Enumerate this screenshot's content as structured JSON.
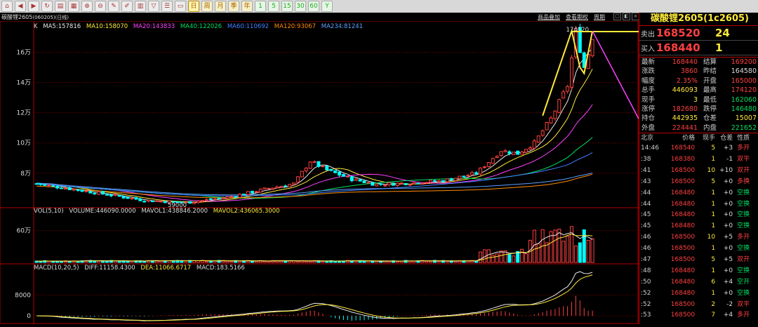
{
  "toolbar": {
    "buttons": [
      "home-icon",
      "back-icon",
      "forward-icon",
      "refresh-icon",
      "chart-icon",
      "grid-icon",
      "zoom-in-icon",
      "zoom-out-icon",
      "draw-icon",
      "pen-icon",
      "indicator-icon",
      "filter-icon",
      "list-icon",
      "window-icon",
      "one-min",
      "five-min",
      "fifteen-min",
      "thirty-min",
      "sixty-min",
      "daily",
      "weekly",
      "monthly",
      "quarterly",
      "yearly",
      "custom"
    ],
    "labels": [
      "⌂",
      "◀",
      "▶",
      "↻",
      "▤",
      "▦",
      "⊕",
      "⊖",
      "✎",
      "✐",
      "▥",
      "▽",
      "☰",
      "▭",
      "日",
      "周",
      "月",
      "季",
      "年",
      "1",
      "5",
      "15",
      "30",
      "60",
      "Y"
    ]
  },
  "header": {
    "symbol": "碳酸锂2605",
    "symbol_code": "(060205)",
    "period": "(日线)",
    "link_overlay": "商品叠加",
    "link_period": "查看期权",
    "link_cycle": "周期",
    "win_buttons": [
      "▢",
      "◧",
      "×"
    ]
  },
  "indicators": {
    "k_label": "K",
    "ma5": "MA5:157816",
    "ma10": "MA10:158070",
    "ma20": "MA20:143833",
    "ma40": "MA40:122026",
    "ma60": "MA60:110692",
    "ma120": "MA120:93067",
    "ma234": "MA234:81241",
    "vol_title": "VOL(5,10)",
    "volume": "VOLUME:446090.0000",
    "mavol1": "MAVOL1:438846.2000",
    "mavol2": "MAVOL2:436065.3000",
    "macd_title": "MACD(10,20,5)",
    "diff": "DIFF:11158.4300",
    "dea": "DEA:11066.6717",
    "macd": "MACD:183.5166"
  },
  "axis": {
    "price_labels": [
      "16万",
      "14万",
      "12万",
      "10万",
      "8万"
    ],
    "vol_label": "60万",
    "macd_labels": [
      "8000",
      "0"
    ],
    "low_label": "59000",
    "high_label": "174120"
  },
  "colors": {
    "up": "#ff4040",
    "down": "#00ffff",
    "ma5": "#e8e8e8",
    "ma10": "#ffea3a",
    "ma20": "#ff40ff",
    "ma40": "#00e060",
    "ma60": "#4080ff",
    "ma120": "#ff8c00",
    "ma234": "#5aa0ff"
  },
  "quote": {
    "title": "碳酸锂2605(1c2605)",
    "ask_label": "卖出",
    "ask_price": "168520",
    "ask_vol": "24",
    "bid_label": "买入",
    "bid_price": "168440",
    "bid_vol": "1",
    "rows": [
      {
        "l": "最新",
        "v1": "168440",
        "c1": "red",
        "l2": "结算",
        "v2": "169200",
        "c2": "red"
      },
      {
        "l": "涨跌",
        "v1": "3860",
        "c1": "red",
        "l2": "昨结",
        "v2": "164580",
        "c2": "white"
      },
      {
        "l": "幅度",
        "v1": "2.35%",
        "c1": "red",
        "l2": "开盘",
        "v2": "165000",
        "c2": "red"
      },
      {
        "l": "总手",
        "v1": "446093",
        "c1": "yellow",
        "l2": "最高",
        "v2": "174120",
        "c2": "red"
      },
      {
        "l": "现手",
        "v1": "3",
        "c1": "yellow",
        "l2": "最低",
        "v2": "162060",
        "c2": "green"
      },
      {
        "l": "涨停",
        "v1": "182680",
        "c1": "red",
        "l2": "跌停",
        "v2": "146480",
        "c2": "green"
      },
      {
        "l": "持仓",
        "v1": "442935",
        "c1": "yellow",
        "l2": "仓差",
        "v2": "15007",
        "c2": "yellow"
      },
      {
        "l": "外盘",
        "v1": "224441",
        "c1": "red",
        "l2": "内盘",
        "v2": "221652",
        "c2": "green"
      }
    ]
  },
  "ticks": {
    "headers": [
      "北京",
      "价格",
      "现手",
      "仓差",
      "性质"
    ],
    "rows": [
      {
        "t": "14:46",
        "p": "168540",
        "v": "5",
        "oi": "+3",
        "n": "多开",
        "pc": "red",
        "nc": "red"
      },
      {
        "t": ":38",
        "p": "168380",
        "v": "1",
        "oi": "-1",
        "n": "双平",
        "pc": "red",
        "nc": "red"
      },
      {
        "t": ":41",
        "p": "168500",
        "v": "10",
        "oi": "+10",
        "n": "双开",
        "pc": "red",
        "nc": "red"
      },
      {
        "t": ":43",
        "p": "168500",
        "v": "5",
        "oi": "+0",
        "n": "多换",
        "pc": "red",
        "nc": "red"
      },
      {
        "t": ":44",
        "p": "168480",
        "v": "1",
        "oi": "+0",
        "n": "空换",
        "pc": "red",
        "nc": "green"
      },
      {
        "t": ":44",
        "p": "168480",
        "v": "1",
        "oi": "+0",
        "n": "空换",
        "pc": "red",
        "nc": "green"
      },
      {
        "t": ":45",
        "p": "168480",
        "v": "1",
        "oi": "+0",
        "n": "空换",
        "pc": "red",
        "nc": "green"
      },
      {
        "t": ":45",
        "p": "168480",
        "v": "1",
        "oi": "+0",
        "n": "空换",
        "pc": "red",
        "nc": "green"
      },
      {
        "t": ":46",
        "p": "168500",
        "v": "10",
        "oi": "+5",
        "n": "多开",
        "pc": "red",
        "nc": "red"
      },
      {
        "t": ":46",
        "p": "168500",
        "v": "1",
        "oi": "+0",
        "n": "空换",
        "pc": "red",
        "nc": "green"
      },
      {
        "t": ":47",
        "p": "168500",
        "v": "5",
        "oi": "+5",
        "n": "双开",
        "pc": "red",
        "nc": "red"
      },
      {
        "t": ":48",
        "p": "168480",
        "v": "1",
        "oi": "+0",
        "n": "空换",
        "pc": "red",
        "nc": "green"
      },
      {
        "t": ":50",
        "p": "168480",
        "v": "6",
        "oi": "+4",
        "n": "空开",
        "pc": "red",
        "nc": "green"
      },
      {
        "t": ":52",
        "p": "168480",
        "v": "1",
        "oi": "+0",
        "n": "空换",
        "pc": "red",
        "nc": "green"
      },
      {
        "t": ":52",
        "p": "168500",
        "v": "2",
        "oi": "-2",
        "n": "双平",
        "pc": "red",
        "nc": "red"
      },
      {
        "t": ":53",
        "p": "168500",
        "v": "7",
        "oi": "+4",
        "n": "多开",
        "pc": "red",
        "nc": "red"
      }
    ]
  },
  "chart_data": {
    "type": "candlestick",
    "y_unit": "yuan",
    "ylim": [
      59000,
      176000
    ],
    "ma_current": {
      "MA5": 157816,
      "MA10": 158070,
      "MA20": 143833,
      "MA40": 122026,
      "MA60": 110692,
      "MA120": 93067,
      "MA234": 81241
    },
    "recent_high": 174120,
    "period_low": 59000,
    "last": 168440,
    "volume_last": 446090,
    "macd": {
      "diff": 11158.43,
      "dea": 11066.6717,
      "macd": 183.5166
    }
  }
}
